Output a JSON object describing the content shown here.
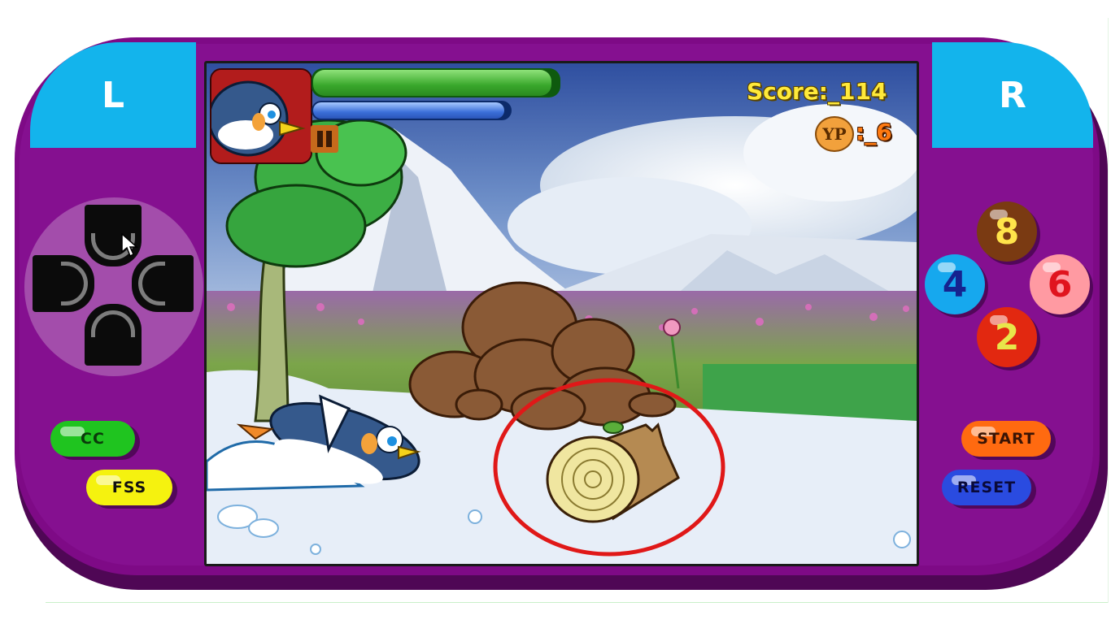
{
  "shoulder_buttons": {
    "left": "L",
    "right": "R"
  },
  "left_buttons": {
    "cc": "CC",
    "fss": "FSS"
  },
  "right_buttons": {
    "start": "START",
    "reset": "RESET"
  },
  "number_buttons": {
    "up": "8",
    "left": "4",
    "right": "6",
    "down": "2"
  },
  "hud": {
    "score": "Score:_114",
    "yp_label": "YP",
    "yp_value": ":_6",
    "health_fraction": 0.97,
    "energy_fraction": 0.97
  },
  "colors": {
    "console": "#7e0a86",
    "shoulder": "#13b4ec",
    "highlight_circle": "#e01818"
  },
  "icons": {
    "pause": "pause-icon",
    "dpad": "dpad-icon",
    "cursor": "mouse-cursor-icon"
  }
}
